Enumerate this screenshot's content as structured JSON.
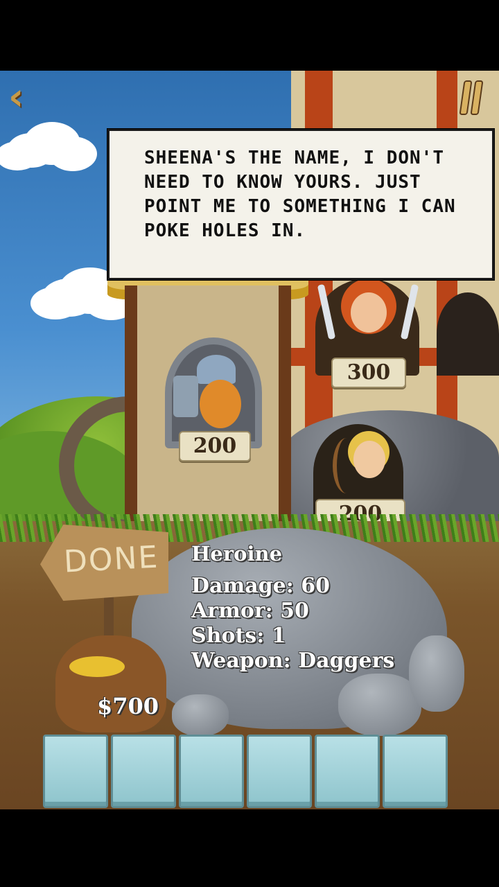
{
  "speech": {
    "text": "Sheena's the name, I don't need to know yours. Just point me to something I can poke holes in."
  },
  "heroes": [
    {
      "name": "viking",
      "price": "200"
    },
    {
      "name": "heroine",
      "price": "300"
    },
    {
      "name": "elf-archer",
      "price": "200"
    }
  ],
  "selected": {
    "name": "Heroine",
    "stats": [
      "Damage: 60",
      "Armor: 50",
      "Shots: 1",
      "Weapon: Daggers"
    ]
  },
  "done_label": "DONE",
  "money": "$700",
  "slots_count": 6,
  "colors": {
    "sky": "#4a8fd0",
    "stone": "#7a8088",
    "slot": "#a8d4da"
  }
}
